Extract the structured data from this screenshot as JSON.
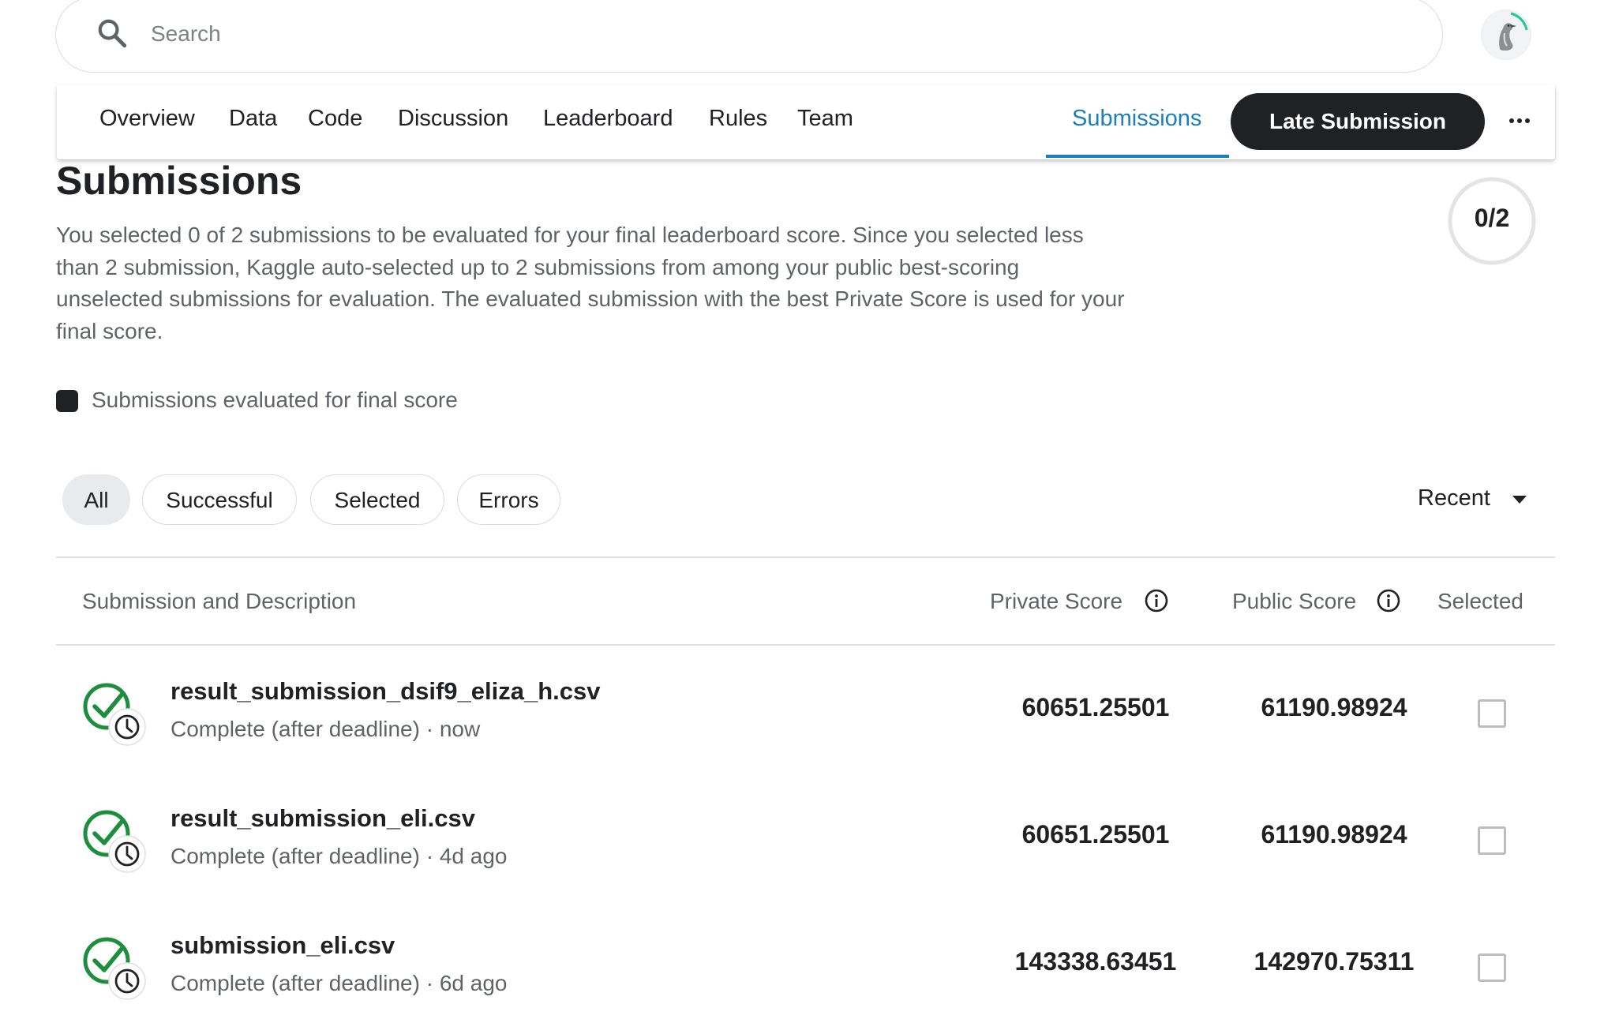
{
  "search": {
    "placeholder": "Search"
  },
  "nav": {
    "tabs": [
      "Overview",
      "Data",
      "Code",
      "Discussion",
      "Leaderboard",
      "Rules",
      "Team"
    ],
    "active_tab": "Submissions",
    "late_submission_label": "Late Submission"
  },
  "header": {
    "title": "Submissions",
    "description": "You selected 0 of 2 submissions to be evaluated for your final leaderboard score. Since you selected less than 2 submission, Kaggle auto-selected up to 2 submissions from among your public best-scoring unselected submissions for evaluation. The evaluated submission with the best Private Score is used for your final score.",
    "selection_count": "0/2",
    "legend_label": "Submissions evaluated for final score"
  },
  "filters": {
    "chips": [
      "All",
      "Successful",
      "Selected",
      "Errors"
    ],
    "active_chip": "All",
    "sort_label": "Recent"
  },
  "table": {
    "columns": {
      "submission": "Submission and Description",
      "private_score": "Private Score",
      "public_score": "Public Score",
      "selected": "Selected"
    },
    "rows": [
      {
        "file": "result_submission_dsif9_eliza_h.csv",
        "status": "Complete (after deadline) · now",
        "private_score": "60651.25501",
        "public_score": "61190.98924",
        "selected": false
      },
      {
        "file": "result_submission_eli.csv",
        "status": "Complete (after deadline) · 4d ago",
        "private_score": "60651.25501",
        "public_score": "61190.98924",
        "selected": false
      },
      {
        "file": "submission_eli.csv",
        "status": "Complete (after deadline) · 6d ago",
        "private_score": "143338.63451",
        "public_score": "142970.75311",
        "selected": false
      }
    ]
  },
  "colors": {
    "accent": "#1a7fbd",
    "success": "#1e8e3e",
    "primary_button": "#202124"
  },
  "icons": {
    "search": "search-icon",
    "more": "more-horizontal-icon",
    "info": "info-icon",
    "status": "check-clock-icon",
    "sort": "caret-down-icon"
  }
}
